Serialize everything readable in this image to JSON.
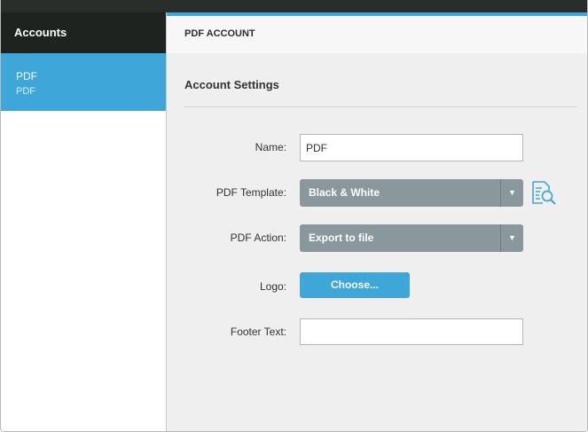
{
  "sidebar": {
    "header": "Accounts",
    "items": [
      {
        "title": "PDF",
        "subtitle": "PDF"
      }
    ]
  },
  "main": {
    "header": "PDF ACCOUNT",
    "section_title": "Account Settings",
    "fields": {
      "name": {
        "label": "Name:",
        "value": "PDF"
      },
      "template": {
        "label": "PDF Template:",
        "value": "Black & White",
        "icon": "template-preview-icon"
      },
      "action": {
        "label": "PDF Action:",
        "value": "Export to file"
      },
      "logo": {
        "label": "Logo:",
        "button": "Choose..."
      },
      "footer": {
        "label": "Footer Text:",
        "value": ""
      }
    }
  },
  "colors": {
    "accent": "#3ea6d8",
    "sidebar_header": "#1f2320",
    "select_bg": "#8a979c"
  }
}
